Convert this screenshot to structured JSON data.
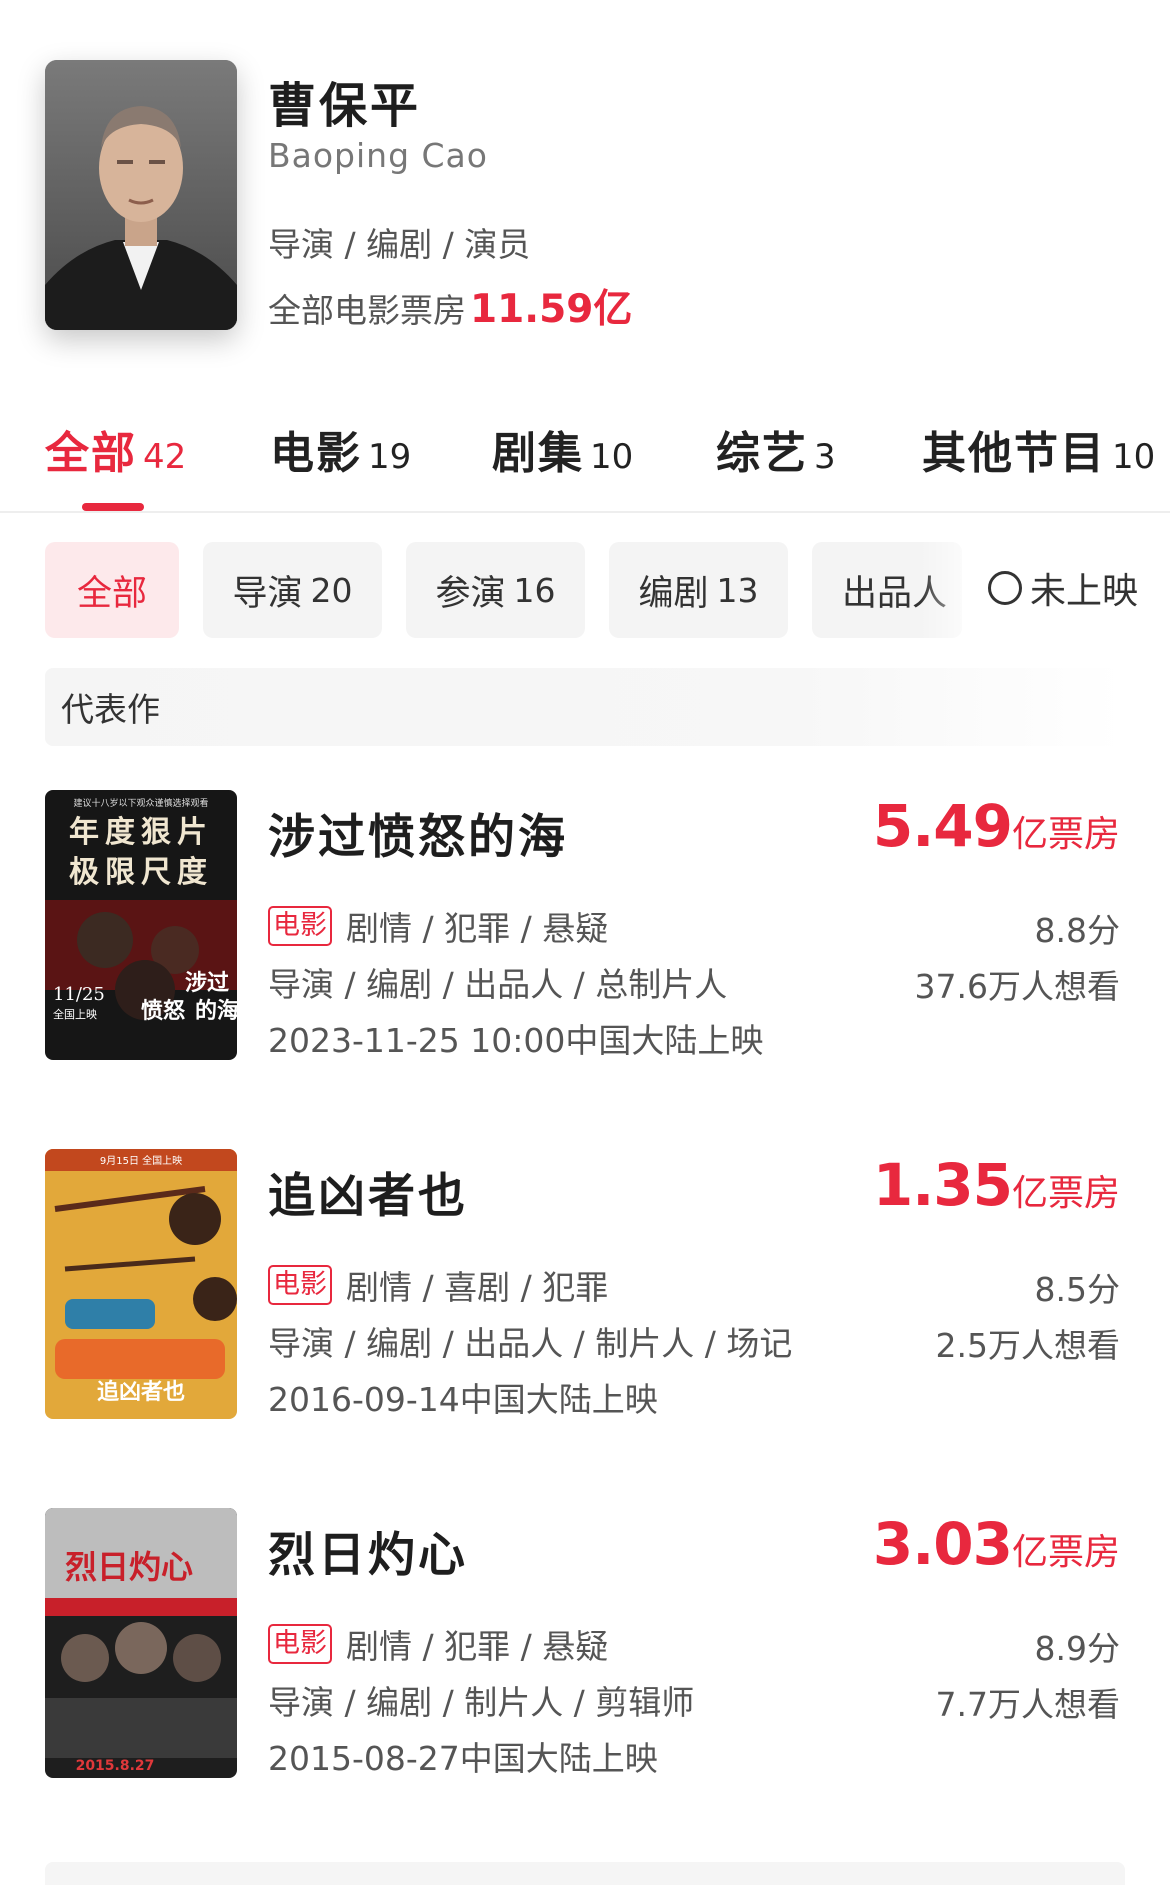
{
  "person": {
    "name_cn": "曹保平",
    "name_en": "Baoping Cao",
    "roles": "导演 / 编剧 / 演员",
    "box_office_label": "全部电影票房",
    "box_office_value": "11.59亿"
  },
  "tabs": [
    {
      "label": "全部",
      "count": "42",
      "active": true
    },
    {
      "label": "电影",
      "count": "19"
    },
    {
      "label": "剧集",
      "count": "10"
    },
    {
      "label": "综艺",
      "count": "3"
    },
    {
      "label": "其他节目",
      "count": "10"
    }
  ],
  "filters": [
    {
      "label": "全部",
      "count": ""
    },
    {
      "label": "导演",
      "count": "20"
    },
    {
      "label": "参演",
      "count": "16"
    },
    {
      "label": "编剧",
      "count": "13"
    },
    {
      "label": "出品人",
      "count": ""
    }
  ],
  "unreleased_label": "未上映",
  "section_title": "代表作",
  "works": [
    {
      "title": "涉过愤怒的海",
      "box_num": "5.49",
      "box_unit": "亿票房",
      "tag": "电影",
      "genres": "剧情 / 犯罪 / 悬疑",
      "jobs": "导演 / 编剧 / 出品人 / 总制片人",
      "release": "2023-11-25 10:00中国大陆上映",
      "score": "8.8分",
      "want": "37.6万人想看",
      "poster_text": [
        "年度狠片",
        "极限尺度",
        "11/25",
        "全国上映",
        "涉过",
        "愤怒",
        "的海",
        "建议十八岁以下观众谨慎选择观看"
      ]
    },
    {
      "title": "追凶者也",
      "box_num": "1.35",
      "box_unit": "亿票房",
      "tag": "电影",
      "genres": "剧情 / 喜剧 / 犯罪",
      "jobs": "导演 / 编剧 / 出品人 / 制片人 / 场记",
      "release": "2016-09-14中国大陆上映",
      "score": "8.5分",
      "want": "2.5万人想看",
      "poster_text": [
        "追凶者也",
        "9月15日 全国上映"
      ]
    },
    {
      "title": "烈日灼心",
      "box_num": "3.03",
      "box_unit": "亿票房",
      "tag": "电影",
      "genres": "剧情 / 犯罪 / 悬疑",
      "jobs": "导演 / 编剧 / 制片人 / 剪辑师",
      "release": "2015-08-27中国大陆上映",
      "score": "8.9分",
      "want": "7.7万人想看",
      "poster_text": [
        "烈日灼心",
        "2015.8.27"
      ]
    }
  ],
  "colors": {
    "accent": "#e8283e",
    "chip_bg": "#f4f4f4",
    "chip_active_bg": "#fde9eb"
  }
}
